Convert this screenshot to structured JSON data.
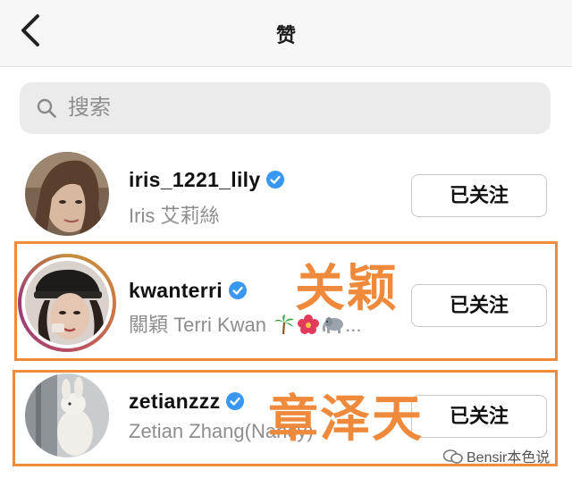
{
  "header": {
    "title": "赞"
  },
  "search": {
    "placeholder": "搜索"
  },
  "users": [
    {
      "username": "iris_1221_lily",
      "full_name": "Iris 艾莉絲",
      "verified": true,
      "button": "已关注"
    },
    {
      "username": "kwanterri",
      "full_name": "關穎 Terri Kwan",
      "verified": true,
      "button": "已关注",
      "story_ring": true
    },
    {
      "username": "zetianzzz",
      "full_name": "Zetian Zhang(Nancy)",
      "verified": true,
      "button": "已关注"
    }
  ],
  "annotations": {
    "kwanterri": "关颖",
    "zetianzzz": "章泽天"
  },
  "watermark": "Bensir本色说",
  "colors": {
    "verified": "#3897f0",
    "highlight": "#ef8a3c"
  }
}
